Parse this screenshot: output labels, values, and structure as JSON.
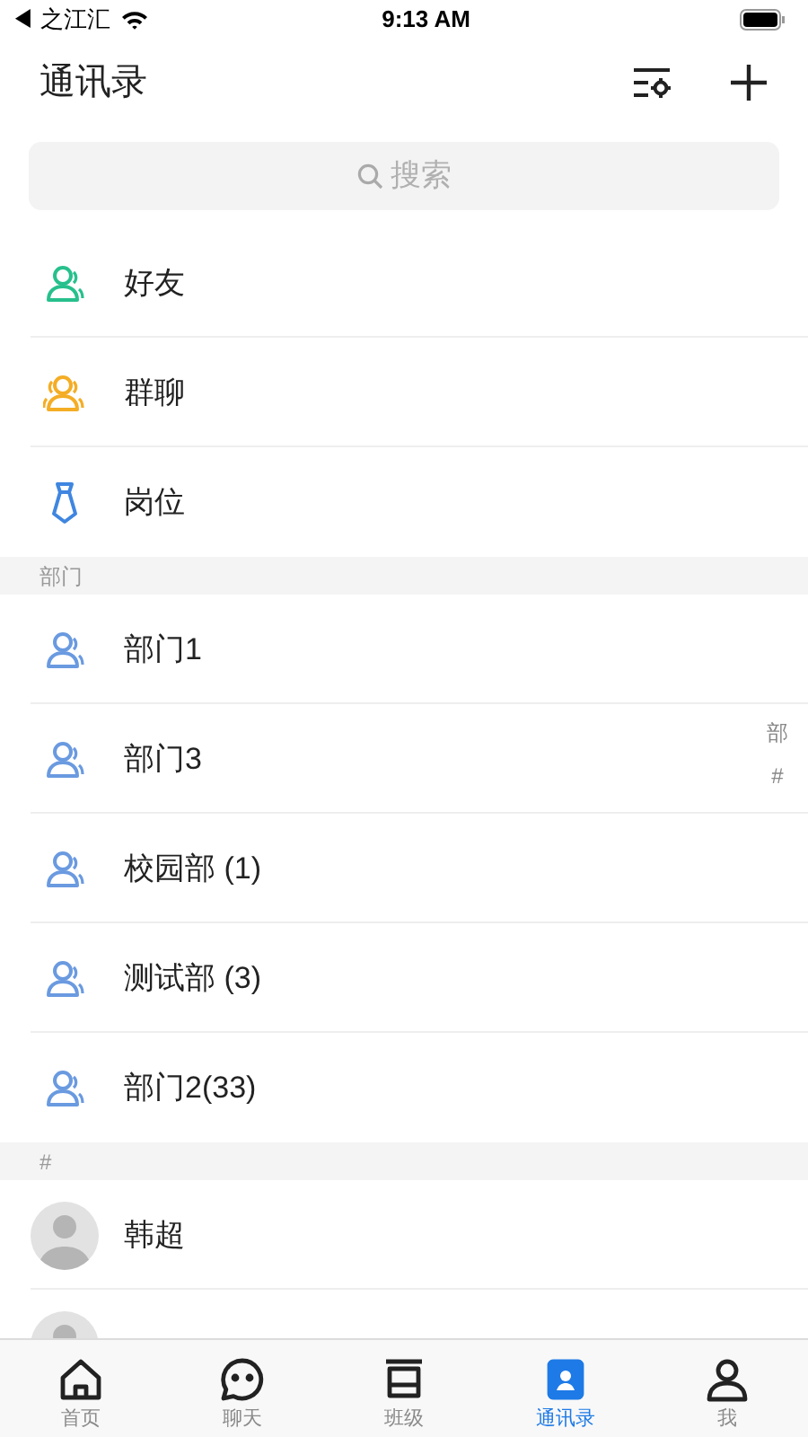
{
  "status_bar": {
    "back_app": "◀ 之江汇",
    "time": "9:13 AM"
  },
  "header": {
    "title": "通讯录"
  },
  "search": {
    "placeholder": "搜索"
  },
  "entries": [
    {
      "kind": "friends",
      "label": "好友"
    },
    {
      "kind": "group",
      "label": "群聊"
    },
    {
      "kind": "post",
      "label": "岗位"
    }
  ],
  "sections": [
    {
      "title": "部门",
      "kind": "department",
      "items": [
        {
          "label": "部门1"
        },
        {
          "label": "部门3"
        },
        {
          "label": "校园部 (1)"
        },
        {
          "label": "测试部 (3)"
        },
        {
          "label": "部门2(33)"
        }
      ]
    },
    {
      "title": "#",
      "kind": "contact",
      "items": [
        {
          "kind": "named",
          "label": "韩超"
        },
        {
          "kind": "covered"
        }
      ]
    }
  ],
  "index_bar": [
    "部",
    "#"
  ],
  "tabs": [
    {
      "label": "首页",
      "kind": "home",
      "selected": false
    },
    {
      "label": "聊天",
      "kind": "chat",
      "selected": false
    },
    {
      "label": "班级",
      "kind": "class",
      "selected": false
    },
    {
      "label": "通讯录",
      "kind": "contacts",
      "selected": true
    },
    {
      "label": "我",
      "kind": "me",
      "selected": false
    }
  ]
}
